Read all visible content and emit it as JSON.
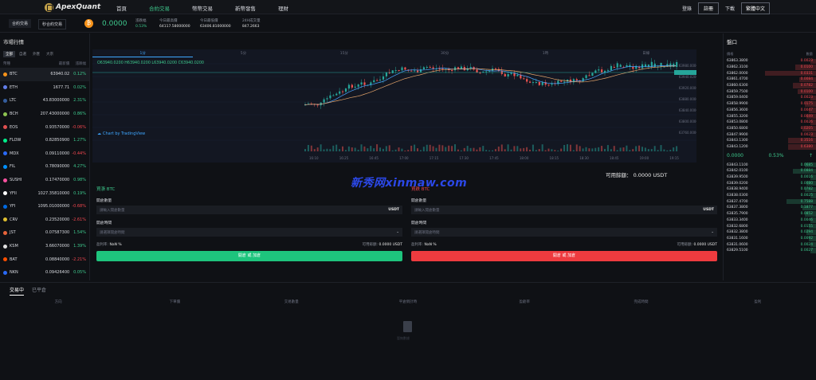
{
  "header": {
    "brand": "ApexQuant",
    "nav": [
      "首頁",
      "合約交易",
      "幣幣交易",
      "新幣發售",
      "理財"
    ],
    "nav_active": 1,
    "login": "登錄",
    "register": "註冊",
    "download": "下載",
    "language": "繁體中文"
  },
  "subbar": {
    "tab_contract": "合約交易",
    "tab_demo": "秒合約交易",
    "price": "0.0000",
    "stats": [
      {
        "label": "漲跌幅",
        "value": "0.53%",
        "green": true
      },
      {
        "label": "今日最高價",
        "value": "64117.58000000"
      },
      {
        "label": "今日最低價",
        "value": "63406.81000000"
      },
      {
        "label": "24H成交量",
        "value": "847.2663"
      }
    ]
  },
  "market": {
    "title": "市場行情",
    "tabs": [
      "全部",
      "自選",
      "外匯",
      "大宗"
    ],
    "columns": [
      "幣種",
      "最新價",
      "漲跌幅"
    ],
    "rows": [
      {
        "symbol": "BTC",
        "price": "63940.02",
        "change": "0.12%",
        "dir": "up",
        "color": "#f7931a"
      },
      {
        "symbol": "ETH",
        "price": "1677.71",
        "change": "0.02%",
        "dir": "up",
        "color": "#627eea"
      },
      {
        "symbol": "LTC",
        "price": "43.83000000",
        "change": "2.31%",
        "dir": "up",
        "color": "#345d9d"
      },
      {
        "symbol": "BCH",
        "price": "207.43000000",
        "change": "0.86%",
        "dir": "up",
        "color": "#8dc351"
      },
      {
        "symbol": "EOS",
        "price": "0.93570000",
        "change": "-0.06%",
        "dir": "down",
        "color": "#e05050"
      },
      {
        "symbol": "FLOW",
        "price": "0.82850900",
        "change": "1.27%",
        "dir": "up",
        "color": "#00ef8b"
      },
      {
        "symbol": "MDX",
        "price": "0.09110000",
        "change": "-0.44%",
        "dir": "down",
        "color": "#2a6af6"
      },
      {
        "symbol": "FIL",
        "price": "0.78090000",
        "change": "4.27%",
        "dir": "up",
        "color": "#0090ff"
      },
      {
        "symbol": "SUSHI",
        "price": "0.17470000",
        "change": "0.98%",
        "dir": "up",
        "color": "#fa52a0"
      },
      {
        "symbol": "YFII",
        "price": "1027.35810000",
        "change": "0.19%",
        "dir": "up",
        "color": "#ffffff"
      },
      {
        "symbol": "YFI",
        "price": "1095.01000000",
        "change": "-0.68%",
        "dir": "down",
        "color": "#006ae3"
      },
      {
        "symbol": "CRV",
        "price": "0.23520000",
        "change": "-2.61%",
        "dir": "down",
        "color": "#e0c030"
      },
      {
        "symbol": "JST",
        "price": "0.07587300",
        "change": "1.54%",
        "dir": "up",
        "color": "#e8643a"
      },
      {
        "symbol": "KSM",
        "price": "3.66070000",
        "change": "1.39%",
        "dir": "up",
        "color": "#e0e0e0"
      },
      {
        "symbol": "BAT",
        "price": "0.08840000",
        "change": "-2.21%",
        "dir": "down",
        "color": "#ff5000"
      },
      {
        "symbol": "NKN",
        "price": "0.09426400",
        "change": "0.05%",
        "dir": "up",
        "color": "#2a6af6"
      }
    ]
  },
  "chart": {
    "timeframes": [
      "1分",
      "5分",
      "15分",
      "30分",
      "1時",
      "日線"
    ],
    "active": 0,
    "ohlc": "O63940.0200  H63940.0200  L63940.0200  C63940.0200",
    "brand": "Chart by TradingView",
    "price_ticks": [
      "63980.0000",
      "63940.0200",
      "63920.0000",
      "63880.0000",
      "63840.0000",
      "63800.0000",
      "63760.0000"
    ],
    "time_ticks": [
      "16:10",
      "16:25",
      "16:45",
      "17:00",
      "17:15",
      "17:30",
      "17:45",
      "18:00",
      "18:15",
      "18:30",
      "18:45",
      "19:00",
      "19:15",
      "19"
    ]
  },
  "balance": "可用餘額： 0.0000 USDT",
  "watermark": "新秀网xinmaw.com",
  "buy": {
    "title": "買漲 BTC",
    "qty_label": "開倉數量",
    "qty_placeholder": "請輸入開倉數量",
    "unit": "USDT",
    "time_label": "開倉時間",
    "time_placeholder": "請選擇開倉時間",
    "profit_label": "盈利率:",
    "profit_value": "NaN %",
    "avail_label": "可用餘額:",
    "avail_value": "0.0000 USDT",
    "button": "開倉 或 加倉"
  },
  "sell": {
    "title": "買跌 BTC",
    "qty_label": "開倉數量",
    "qty_placeholder": "請輸入開倉數量",
    "unit": "USDT",
    "time_label": "開倉時間",
    "time_placeholder": "請選擇開倉時間",
    "profit_label": "盈利率:",
    "profit_value": "NaN %",
    "avail_label": "可用餘額:",
    "avail_value": "0.0000 USDT",
    "button": "開倉 或 加倉"
  },
  "book": {
    "title": "盤口",
    "col_price": "價格",
    "col_qty": "數量",
    "asks": [
      {
        "price": "63863.3800",
        "qty": "0.0023",
        "depth": 0.06
      },
      {
        "price": "63862.3100",
        "qty": "0.0100",
        "depth": 0.22
      },
      {
        "price": "63862.0000",
        "qty": "0.0331",
        "depth": 0.55
      },
      {
        "price": "63861.4700",
        "qty": "0.0084",
        "depth": 0.18
      },
      {
        "price": "63860.6300",
        "qty": "0.0782",
        "depth": 0.25
      },
      {
        "price": "63859.7500",
        "qty": "0.0100",
        "depth": 0.2
      },
      {
        "price": "63859.0400",
        "qty": "0.0023",
        "depth": 0.06
      },
      {
        "price": "63858.9900",
        "qty": "0.0175",
        "depth": 0.12
      },
      {
        "price": "63856.3600",
        "qty": "0.0047",
        "depth": 0.08
      },
      {
        "price": "63855.3200",
        "qty": "0.0049",
        "depth": 0.1
      },
      {
        "price": "63853.0800",
        "qty": "0.0026",
        "depth": 0.06
      },
      {
        "price": "63850.6800",
        "qty": "0.0205",
        "depth": 0.15
      },
      {
        "price": "63847.9900",
        "qty": "0.0023",
        "depth": 0.06
      },
      {
        "price": "63843.1300",
        "qty": "0.3516",
        "depth": 0.3
      },
      {
        "price": "63843.1200",
        "qty": "0.6380",
        "depth": 0.3
      }
    ],
    "mid_price": "0.0000",
    "mid_change": "0.53%",
    "bids": [
      {
        "price": "63843.1100",
        "qty": "0.0685",
        "depth": 0.12
      },
      {
        "price": "63842.0100",
        "qty": "0.0884",
        "depth": 0.25
      },
      {
        "price": "63839.9500",
        "qty": "0.0016",
        "depth": 0.06
      },
      {
        "price": "63839.0200",
        "qty": "0.0080",
        "depth": 0.1
      },
      {
        "price": "63838.9400",
        "qty": "0.0782",
        "depth": 0.12
      },
      {
        "price": "63838.0300",
        "qty": "0.0025",
        "depth": 0.06
      },
      {
        "price": "63837.4700",
        "qty": "0.7588",
        "depth": 0.32
      },
      {
        "price": "63837.3800",
        "qty": "0.1877",
        "depth": 0.15
      },
      {
        "price": "63835.7900",
        "qty": "0.0852",
        "depth": 0.12
      },
      {
        "price": "63833.3400",
        "qty": "0.0046",
        "depth": 0.06
      },
      {
        "price": "63832.6800",
        "qty": "0.0155",
        "depth": 0.08
      },
      {
        "price": "63832.3800",
        "qty": "0.0294",
        "depth": 0.1
      },
      {
        "price": "63831.1600",
        "qty": "0.0092",
        "depth": 0.08
      },
      {
        "price": "63831.0600",
        "qty": "0.0024",
        "depth": 0.06
      },
      {
        "price": "63829.5100",
        "qty": "0.0027",
        "depth": 0.06
      }
    ]
  },
  "positions": {
    "tabs": [
      "交易中",
      "已平倉"
    ],
    "columns": [
      "方向",
      "下單價",
      "交易數量",
      "平倉倒計時",
      "盈虧率",
      "完成時間",
      "盈利"
    ],
    "empty_text": "暫無數據"
  }
}
